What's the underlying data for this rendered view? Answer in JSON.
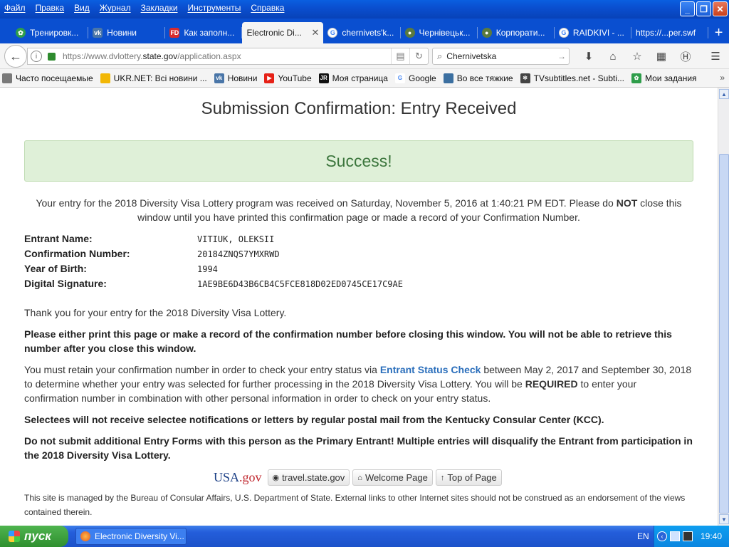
{
  "menu": [
    "Файл",
    "Правка",
    "Вид",
    "Журнал",
    "Закладки",
    "Инструменты",
    "Справка"
  ],
  "tabs": [
    {
      "label": "Тренировк...",
      "icon_color": "#2e9d4a",
      "icon_glyph": "✿"
    },
    {
      "label": "Новини",
      "icon_color": "#4a76a8",
      "icon_glyph": "vk"
    },
    {
      "label": "Как заполн...",
      "icon_color": "#d92b2b",
      "icon_glyph": "FD"
    },
    {
      "label": "Electronic Di...",
      "icon_color": "",
      "icon_glyph": ""
    },
    {
      "label": "chernivets'k...",
      "icon_color": "#4285f4",
      "icon_glyph": "G"
    },
    {
      "label": "Чернівецьк...",
      "icon_color": "#5b7a3d",
      "icon_glyph": "●"
    },
    {
      "label": "Корпорати...",
      "icon_color": "#5b7a3d",
      "icon_glyph": "●"
    },
    {
      "label": "RAIDKIVI - ...",
      "icon_color": "#4285f4",
      "icon_glyph": "G"
    },
    {
      "label": "https://...per.swf",
      "icon_color": "",
      "icon_glyph": ""
    }
  ],
  "nav": {
    "url_prefix": "https://www.dvlottery.",
    "url_domain": "state.gov",
    "url_suffix": "/application.aspx",
    "search_value": "Chernivetska"
  },
  "bookmarks": [
    {
      "label": "Часто посещаемые",
      "icon_color": "#7a7a7a"
    },
    {
      "label": "UKR.NET: Всі новини ...",
      "icon_color": "#f2b705"
    },
    {
      "label": "Новини",
      "icon_color": "#4a76a8"
    },
    {
      "label": "YouTube",
      "icon_color": "#e62117"
    },
    {
      "label": "Моя страница",
      "icon_color": "#111111"
    },
    {
      "label": "Google",
      "icon_color": "#4285f4"
    },
    {
      "label": "Во все тяжкие",
      "icon_color": "#3b6fa0"
    },
    {
      "label": "TVsubtitles.net - Subti...",
      "icon_color": "#444444"
    },
    {
      "label": "Мои задания",
      "icon_color": "#2e9d4a"
    }
  ],
  "page": {
    "title": "Submission Confirmation: Entry Received",
    "alert": "Success!",
    "entry_before": "Your entry for the 2018 Diversity Visa Lottery program was received on Saturday, November 5, 2016 at 1:40:21 PM EDT. Please do ",
    "entry_bold": "NOT",
    "entry_after": " close this window until you have printed this confirmation page or made a record of your Confirmation Number.",
    "fields": [
      {
        "label": "Entrant Name:",
        "value": "VITIUK, OLEKSII"
      },
      {
        "label": "Confirmation Number:",
        "value": "20184ZNQS7YMXRWD"
      },
      {
        "label": "Year of Birth:",
        "value": "1994"
      },
      {
        "label": "Digital Signature:",
        "value": "1AE9BE6D43B6CB4C5FCE818D02ED0745CE17C9AE"
      }
    ],
    "thanks": "Thank you for your entry for the 2018 Diversity Visa Lottery.",
    "print_note": "Please either print this page or make a record of the confirmation number before closing this window. You will not be able to retrieve this number after you close this window.",
    "retain_before": "You must retain your confirmation number in order to check your entry status via ",
    "retain_link": "Entrant Status Check",
    "retain_mid": " between May 2, 2017 and September 30, 2018 to determine whether your entry was selected for further processing in the 2018 Diversity Visa Lottery. You will be ",
    "retain_bold": "REQUIRED",
    "retain_after": " to enter your confirmation number in combination with other personal information in order to check on your entry status.",
    "selectees": "Selectees will not receive selectee notifications or letters by regular postal mail from the Kentucky Consular Center (KCC).",
    "no_submit": "Do not submit additional Entry Forms with this person as the Primary Entrant! Multiple entries will disqualify the Entrant from participation in the 2018 Diversity Visa Lottery.",
    "usa_logo": "USA",
    "usa_logo_gov": ".gov",
    "buttons": [
      "travel.state.gov",
      "Welcome Page",
      "Top of Page"
    ],
    "footnote": "This site is managed by the Bureau of Consular Affairs, U.S. Department of State. External links to other Internet sites should not be construed as an endorsement of the views contained therein."
  },
  "taskbar": {
    "start": "пуск",
    "window": "Electronic Diversity Vi...",
    "lang": "EN",
    "clock": "19:40"
  }
}
